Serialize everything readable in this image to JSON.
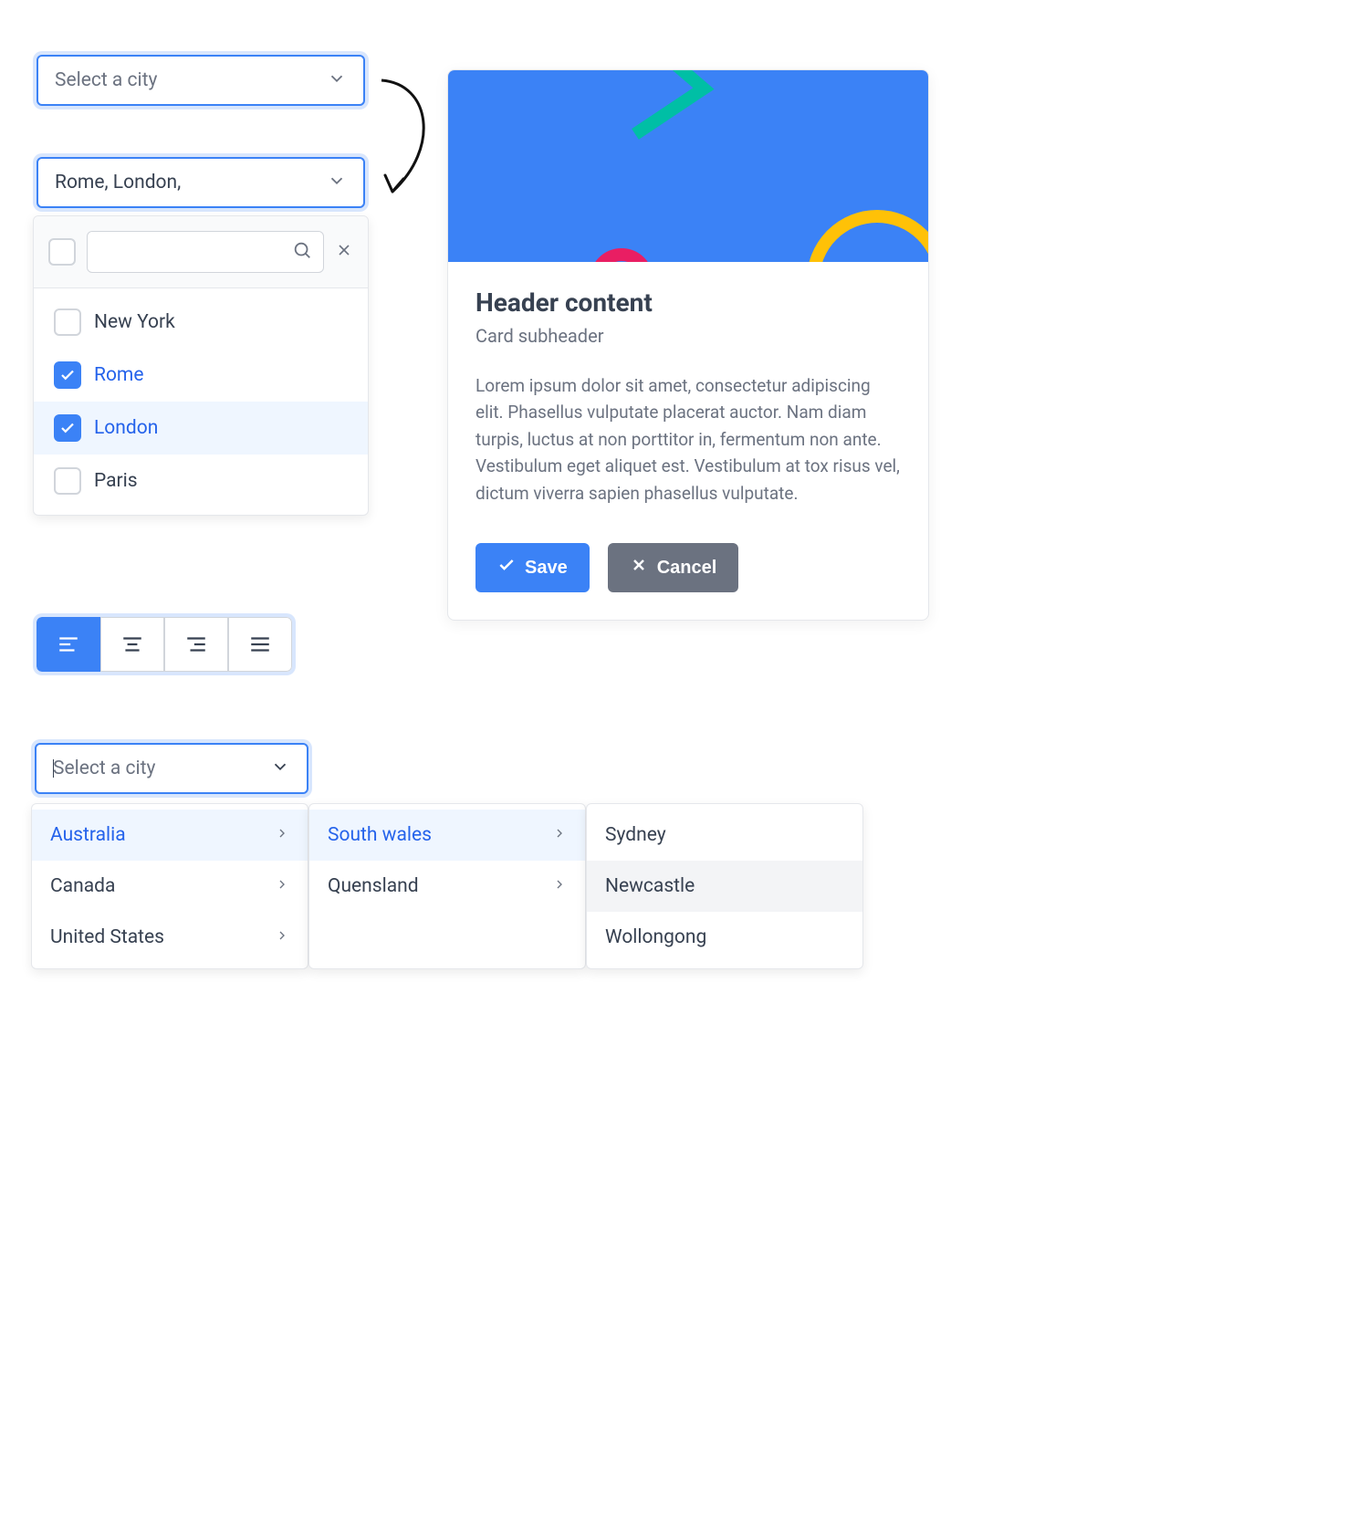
{
  "select1": {
    "placeholder": "Select a city"
  },
  "select2": {
    "value": "Rome, London,",
    "options": [
      {
        "label": "New York",
        "checked": false
      },
      {
        "label": "Rome",
        "checked": true
      },
      {
        "label": "London",
        "checked": true,
        "highlighted": true
      },
      {
        "label": "Paris",
        "checked": false
      }
    ]
  },
  "buttonGroup": {
    "items": [
      "align-left",
      "align-center",
      "align-right",
      "align-justify"
    ],
    "activeIndex": 0
  },
  "card": {
    "title": "Header content",
    "subtitle": "Card subheader",
    "body": "Lorem ipsum dolor sit amet, consectetur adipiscing elit. Phasellus vulputate placerat auctor. Nam diam turpis, luctus at non porttitor in, fermentum non ante. Vestibulum eget aliquet est. Vestibulum at tox risus vel, dictum viverra sapien phasellus vulputate.",
    "actions": {
      "save": "Save",
      "cancel": "Cancel"
    }
  },
  "cascader": {
    "placeholder": "Select a city",
    "panels": [
      [
        {
          "label": "Australia",
          "hasChildren": true,
          "selected": true
        },
        {
          "label": "Canada",
          "hasChildren": true
        },
        {
          "label": "United States",
          "hasChildren": true
        }
      ],
      [
        {
          "label": "South wales",
          "hasChildren": true,
          "selected": true
        },
        {
          "label": "Quensland",
          "hasChildren": true
        }
      ],
      [
        {
          "label": "Sydney"
        },
        {
          "label": "Newcastle",
          "highlighted": true
        },
        {
          "label": "Wollongong"
        }
      ]
    ]
  }
}
